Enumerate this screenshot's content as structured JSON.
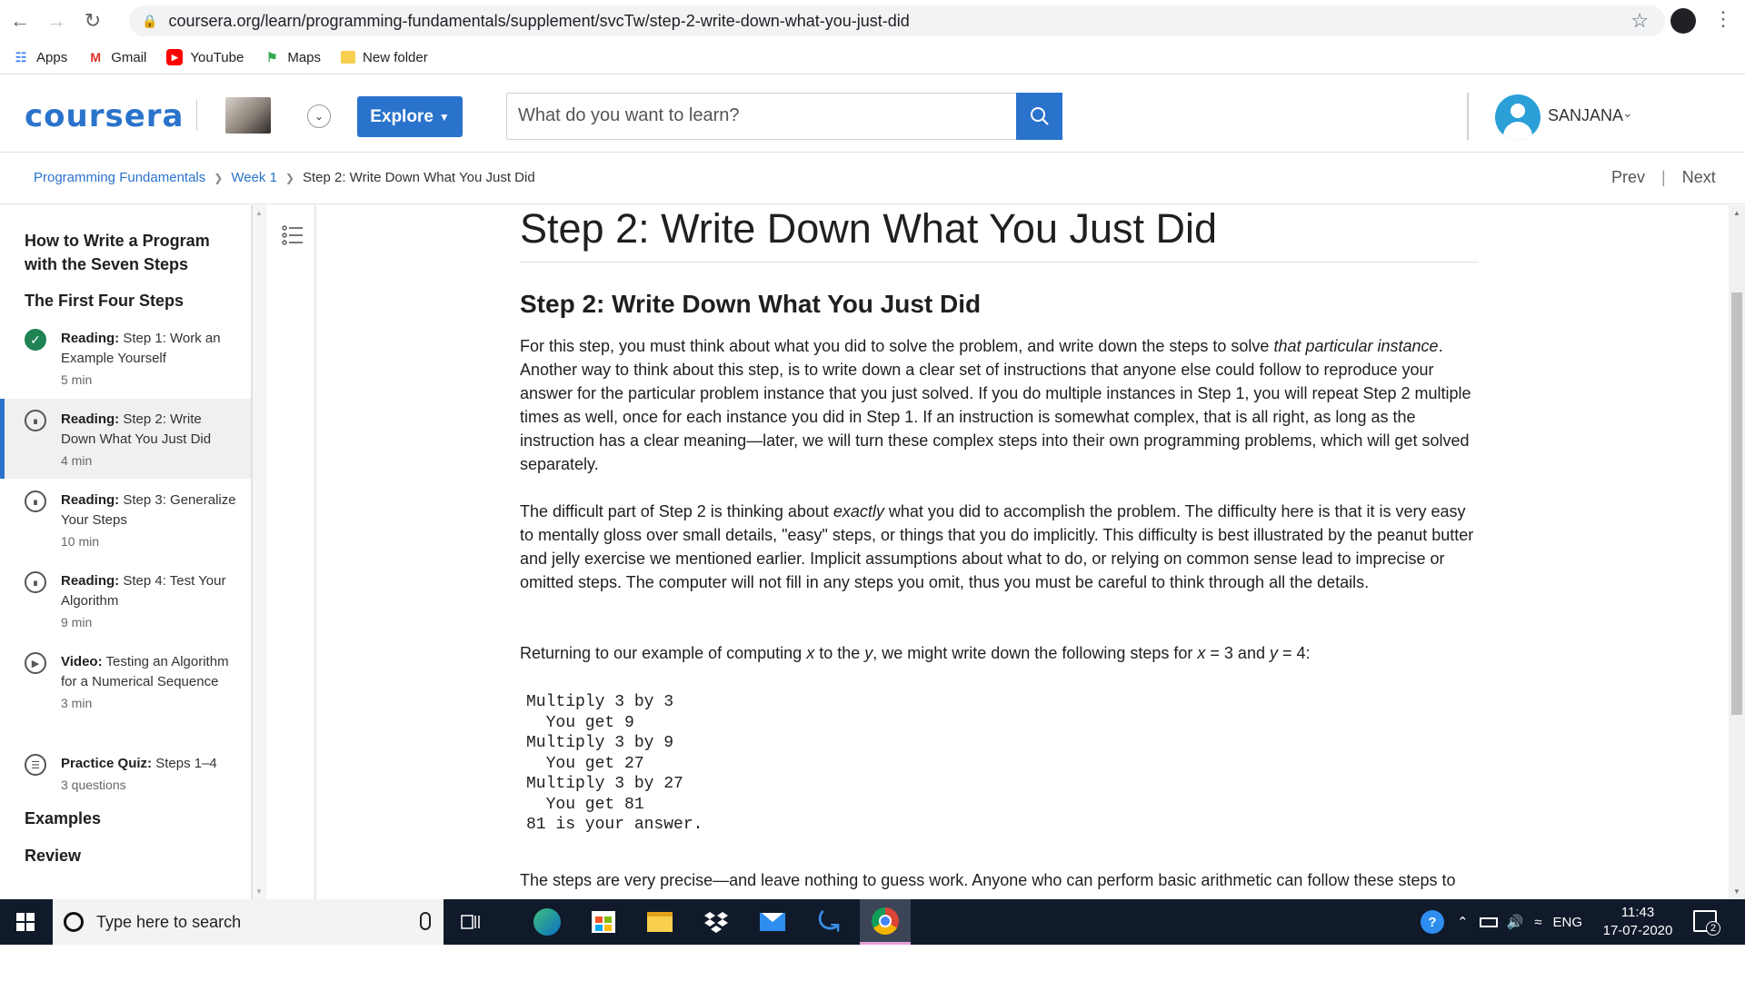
{
  "browser": {
    "url": "coursera.org/learn/programming-fundamentals/supplement/svcTw/step-2-write-down-what-you-just-did",
    "bookmarks": [
      "Apps",
      "Gmail",
      "YouTube",
      "Maps",
      "New folder"
    ]
  },
  "header": {
    "logo": "coursera",
    "explore_label": "Explore",
    "search_placeholder": "What do you want to learn?",
    "username": "SANJANA"
  },
  "breadcrumb": {
    "items": [
      "Programming Fundamentals",
      "Week 1",
      "Step 2: Write Down What You Just Did"
    ],
    "prev": "Prev",
    "next": "Next"
  },
  "sidebar": {
    "module_title": "How to Write a Program with the Seven Steps",
    "section_title": "The First Four Steps",
    "items": [
      {
        "type": "Reading:",
        "title": "Step 1: Work an Example Yourself",
        "meta": "5 min",
        "status": "done"
      },
      {
        "type": "Reading:",
        "title": "Step 2: Write Down What You Just Did",
        "meta": "4 min",
        "status": "active"
      },
      {
        "type": "Reading:",
        "title": "Step 3: Generalize Your Steps",
        "meta": "10 min",
        "status": "todo"
      },
      {
        "type": "Reading:",
        "title": "Step 4: Test Your Algorithm",
        "meta": "9 min",
        "status": "todo"
      },
      {
        "type": "Video:",
        "title": "Testing an Algorithm for a Numerical Sequence",
        "meta": "3 min",
        "status": "todo"
      },
      {
        "type": "Practice Quiz:",
        "title": "Steps 1–4",
        "meta": "3 questions",
        "status": "todo"
      }
    ],
    "examples": "Examples",
    "review": "Review"
  },
  "content": {
    "page_title": "Step 2: Write Down What You Just Did",
    "heading": "Step 2: Write Down What You Just Did",
    "p1_a": "For this step, you must think about what you did to solve the problem, and write down the steps to solve ",
    "p1_em": "that particular instance",
    "p1_b": ". Another way to think about this step, is to write down a clear set of instructions that anyone else could follow to reproduce your answer for the particular problem instance that you just solved. If you do multiple instances in Step 1, you will repeat Step 2 multiple times as well, once for each instance you did in Step 1. If an instruction is somewhat complex, that is all right, as long as the instruction has a clear meaning—later, we will turn these complex steps into their own programming problems, which will get solved separately.",
    "p2_a": "The difficult part of Step 2 is thinking about ",
    "p2_em": "exactly",
    "p2_b": " what you did to accomplish the problem. The difficulty here is that it is very easy to mentally gloss over small details, \"easy\" steps, or things that you do implicitly. This difficulty is best illustrated by the peanut butter and jelly exercise we mentioned earlier. Implicit assumptions about what to do, or relying on common sense lead to imprecise or omitted steps. The computer will not fill in any steps you omit, thus you must be careful to think through all the details.",
    "p3_a": "Returning to our example of computing ",
    "p3_x": "x",
    "p3_b": " to the ",
    "p3_y": "y",
    "p3_c": ", we might write down the following steps for ",
    "p3_x2": "x",
    "p3_d": " = 3 and ",
    "p3_y2": "y",
    "p3_e": " = 4:",
    "code": "Multiply 3 by 3\n  You get 9\nMultiply 3 by 9\n  You get 27\nMultiply 3 by 27\n  You get 81\n81 is your answer.",
    "p4": "The steps are very precise—and leave nothing to guess work. Anyone who can perform basic arithmetic can follow these steps to"
  },
  "taskbar": {
    "search_placeholder": "Type here to search",
    "lang": "ENG",
    "time": "11:43",
    "date": "17-07-2020",
    "notif_count": "2"
  },
  "colors": {
    "accent": "#2a73cc",
    "done": "#1f8354",
    "taskbar": "#101a2a"
  }
}
